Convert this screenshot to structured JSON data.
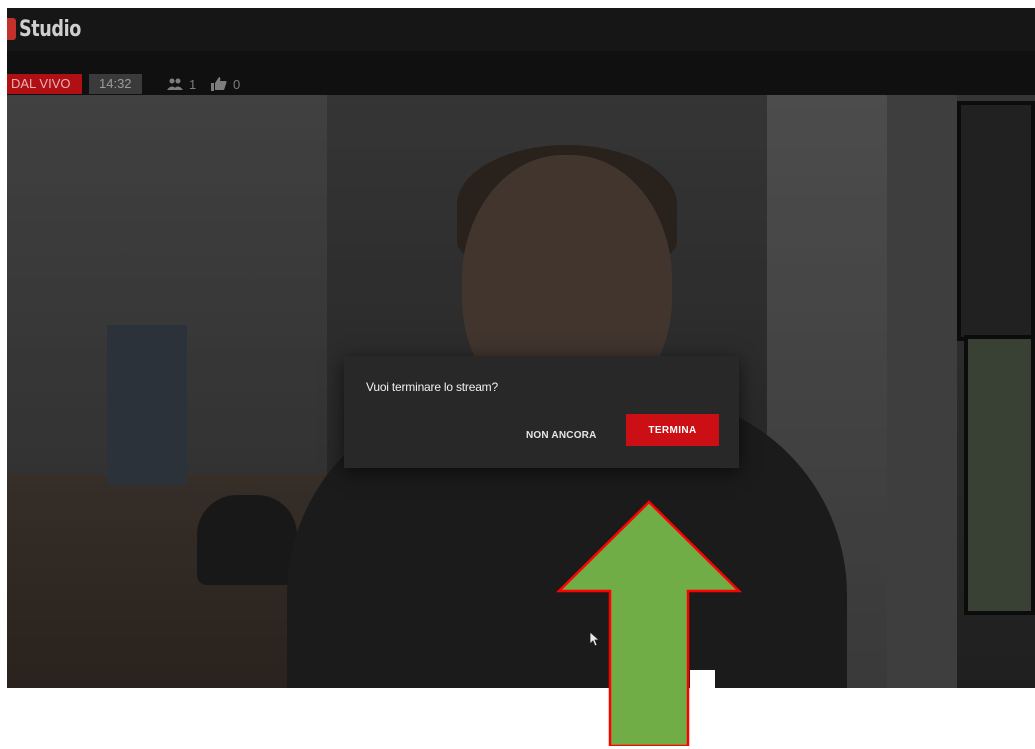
{
  "header": {
    "app_name": "Studio",
    "brand_color": "#c4302b"
  },
  "status": {
    "live_label": "DAL VIVO",
    "time": "14:32",
    "viewers": "1",
    "likes": "0",
    "live_color": "#b00f14"
  },
  "dialog": {
    "title": "Vuoi terminare lo stream?",
    "cancel_label": "NON ANCORA",
    "confirm_label": "TERMINA",
    "confirm_color": "#cc0f14"
  },
  "annotation": {
    "arrow_color": "#70ad47",
    "arrow_outline": "#ff0000",
    "icon": "arrow-up-icon"
  }
}
